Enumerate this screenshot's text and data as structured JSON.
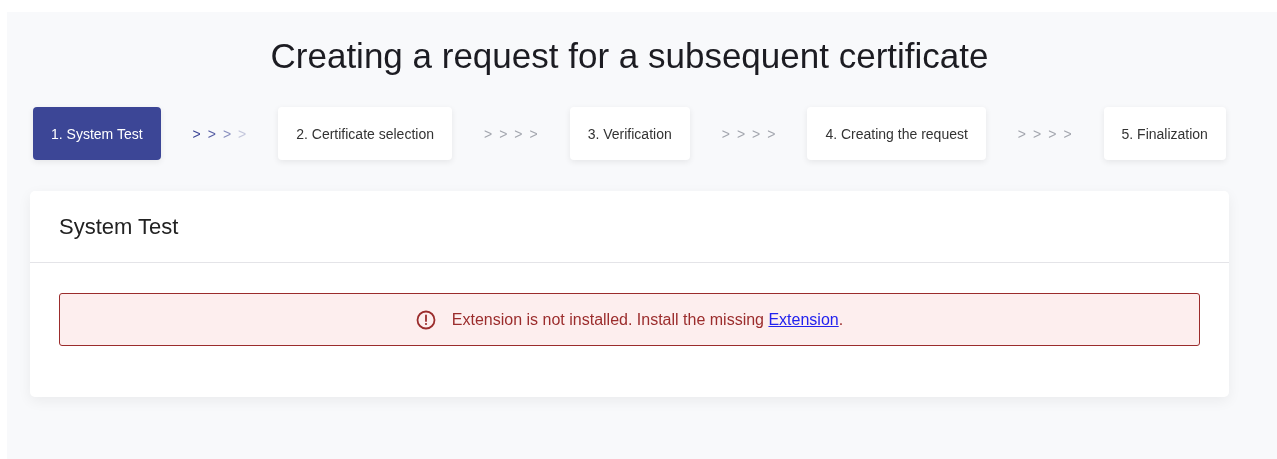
{
  "title": "Creating a request for a subsequent certificate",
  "steps": [
    {
      "label": "1. System Test",
      "selected": true
    },
    {
      "label": "2. Certificate selection",
      "selected": false
    },
    {
      "label": "3. Verification",
      "selected": false
    },
    {
      "label": "4. Creating the request",
      "selected": false
    },
    {
      "label": "5. Finalization",
      "selected": false
    }
  ],
  "separators": [
    {
      "active": true,
      "marks": [
        ">",
        ">",
        ">",
        ">"
      ]
    },
    {
      "active": false,
      "marks": [
        ">",
        ">",
        ">",
        ">"
      ]
    },
    {
      "active": false,
      "marks": [
        ">",
        ">",
        ">",
        ">"
      ]
    },
    {
      "active": false,
      "marks": [
        ">",
        ">",
        ">",
        ">"
      ]
    }
  ],
  "card": {
    "title": "System Test",
    "alert": {
      "kind": "error",
      "text": "Extension is not installed. Install the missing ",
      "link": "Extension",
      "suffix": "."
    }
  }
}
